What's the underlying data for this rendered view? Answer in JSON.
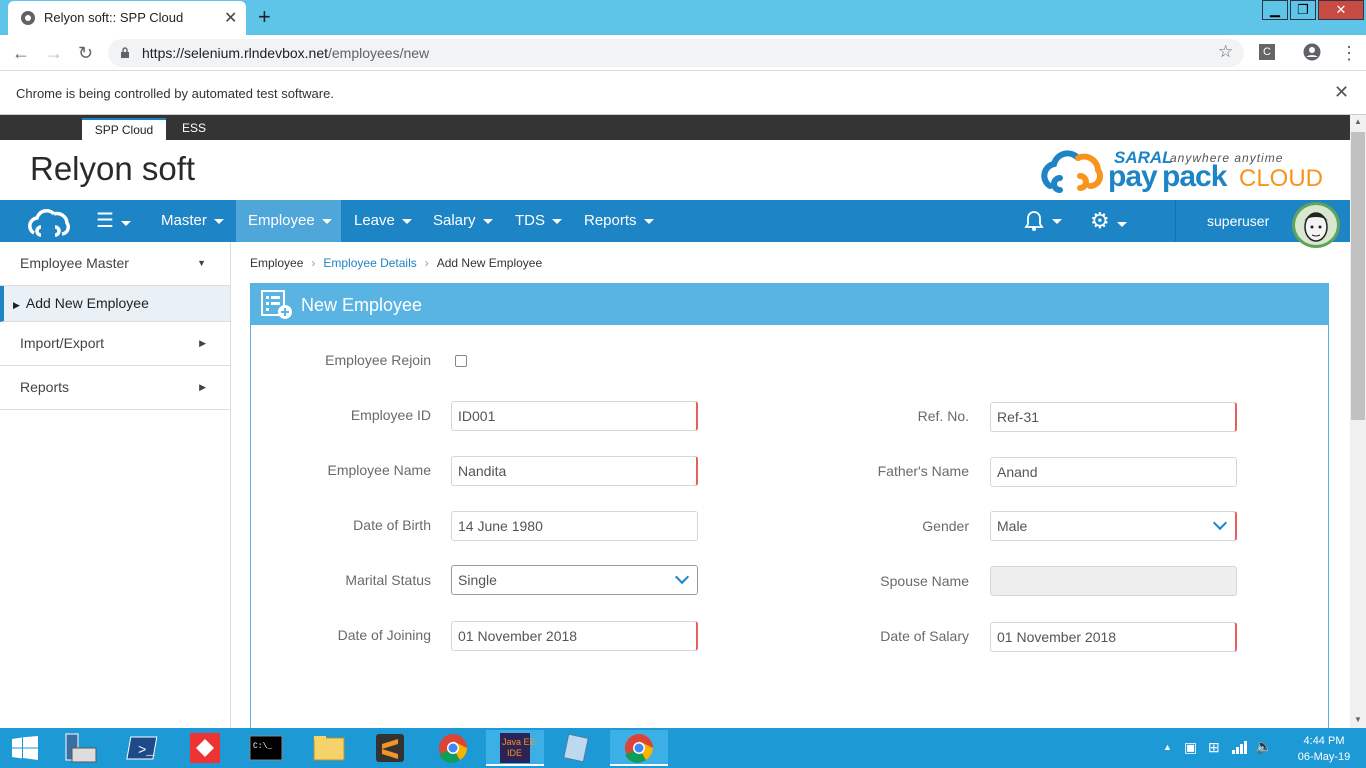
{
  "browser": {
    "tab_title": "Relyon soft:: SPP Cloud",
    "url_host": "https://selenium.rlndevbox.net",
    "url_path": "/employees/new",
    "automation_msg": "Chrome is being controlled by automated test software."
  },
  "app_tabs": {
    "spp": "SPP Cloud",
    "ess": "ESS"
  },
  "header": {
    "brand": "Relyon soft",
    "logo_saral": "SARAL",
    "logo_tagline": "anywhere anytime",
    "logo_pay": "pay",
    "logo_pack": "pack",
    "logo_cloud": "CLOUD"
  },
  "nav": {
    "items": [
      "Master",
      "Employee",
      "Leave",
      "Salary",
      "TDS",
      "Reports"
    ],
    "user": "superuser",
    "active": "Employee"
  },
  "sidebar": {
    "employee_master": "Employee Master",
    "add_new": "Add New Employee",
    "import_export": "Import/Export",
    "reports": "Reports"
  },
  "breadcrumb": {
    "root": "Employee",
    "details": "Employee Details",
    "current": "Add New Employee"
  },
  "form": {
    "title": "New Employee",
    "rejoin_label": "Employee Rejoin",
    "employee_id_label": "Employee ID",
    "employee_id": "ID001",
    "ref_no_label": "Ref. No.",
    "ref_no": "Ref-31",
    "employee_name_label": "Employee Name",
    "employee_name": "Nandita",
    "fathers_name_label": "Father's Name",
    "fathers_name": "Anand",
    "dob_label": "Date of Birth",
    "dob": "14 June 1980",
    "gender_label": "Gender",
    "gender": "Male",
    "marital_label": "Marital Status",
    "marital": "Single",
    "spouse_label": "Spouse Name",
    "spouse": "",
    "doj_label": "Date of Joining",
    "doj": "01 November 2018",
    "dos_label": "Date of Salary",
    "dos": "01 November 2018"
  },
  "taskbar": {
    "time": "4:44 PM",
    "date": "06-May-19"
  },
  "colors": {
    "nav": "#1d84c6",
    "panel": "#5ab4e3",
    "chrome": "#5ec4e8",
    "required": "#e65f5f"
  }
}
